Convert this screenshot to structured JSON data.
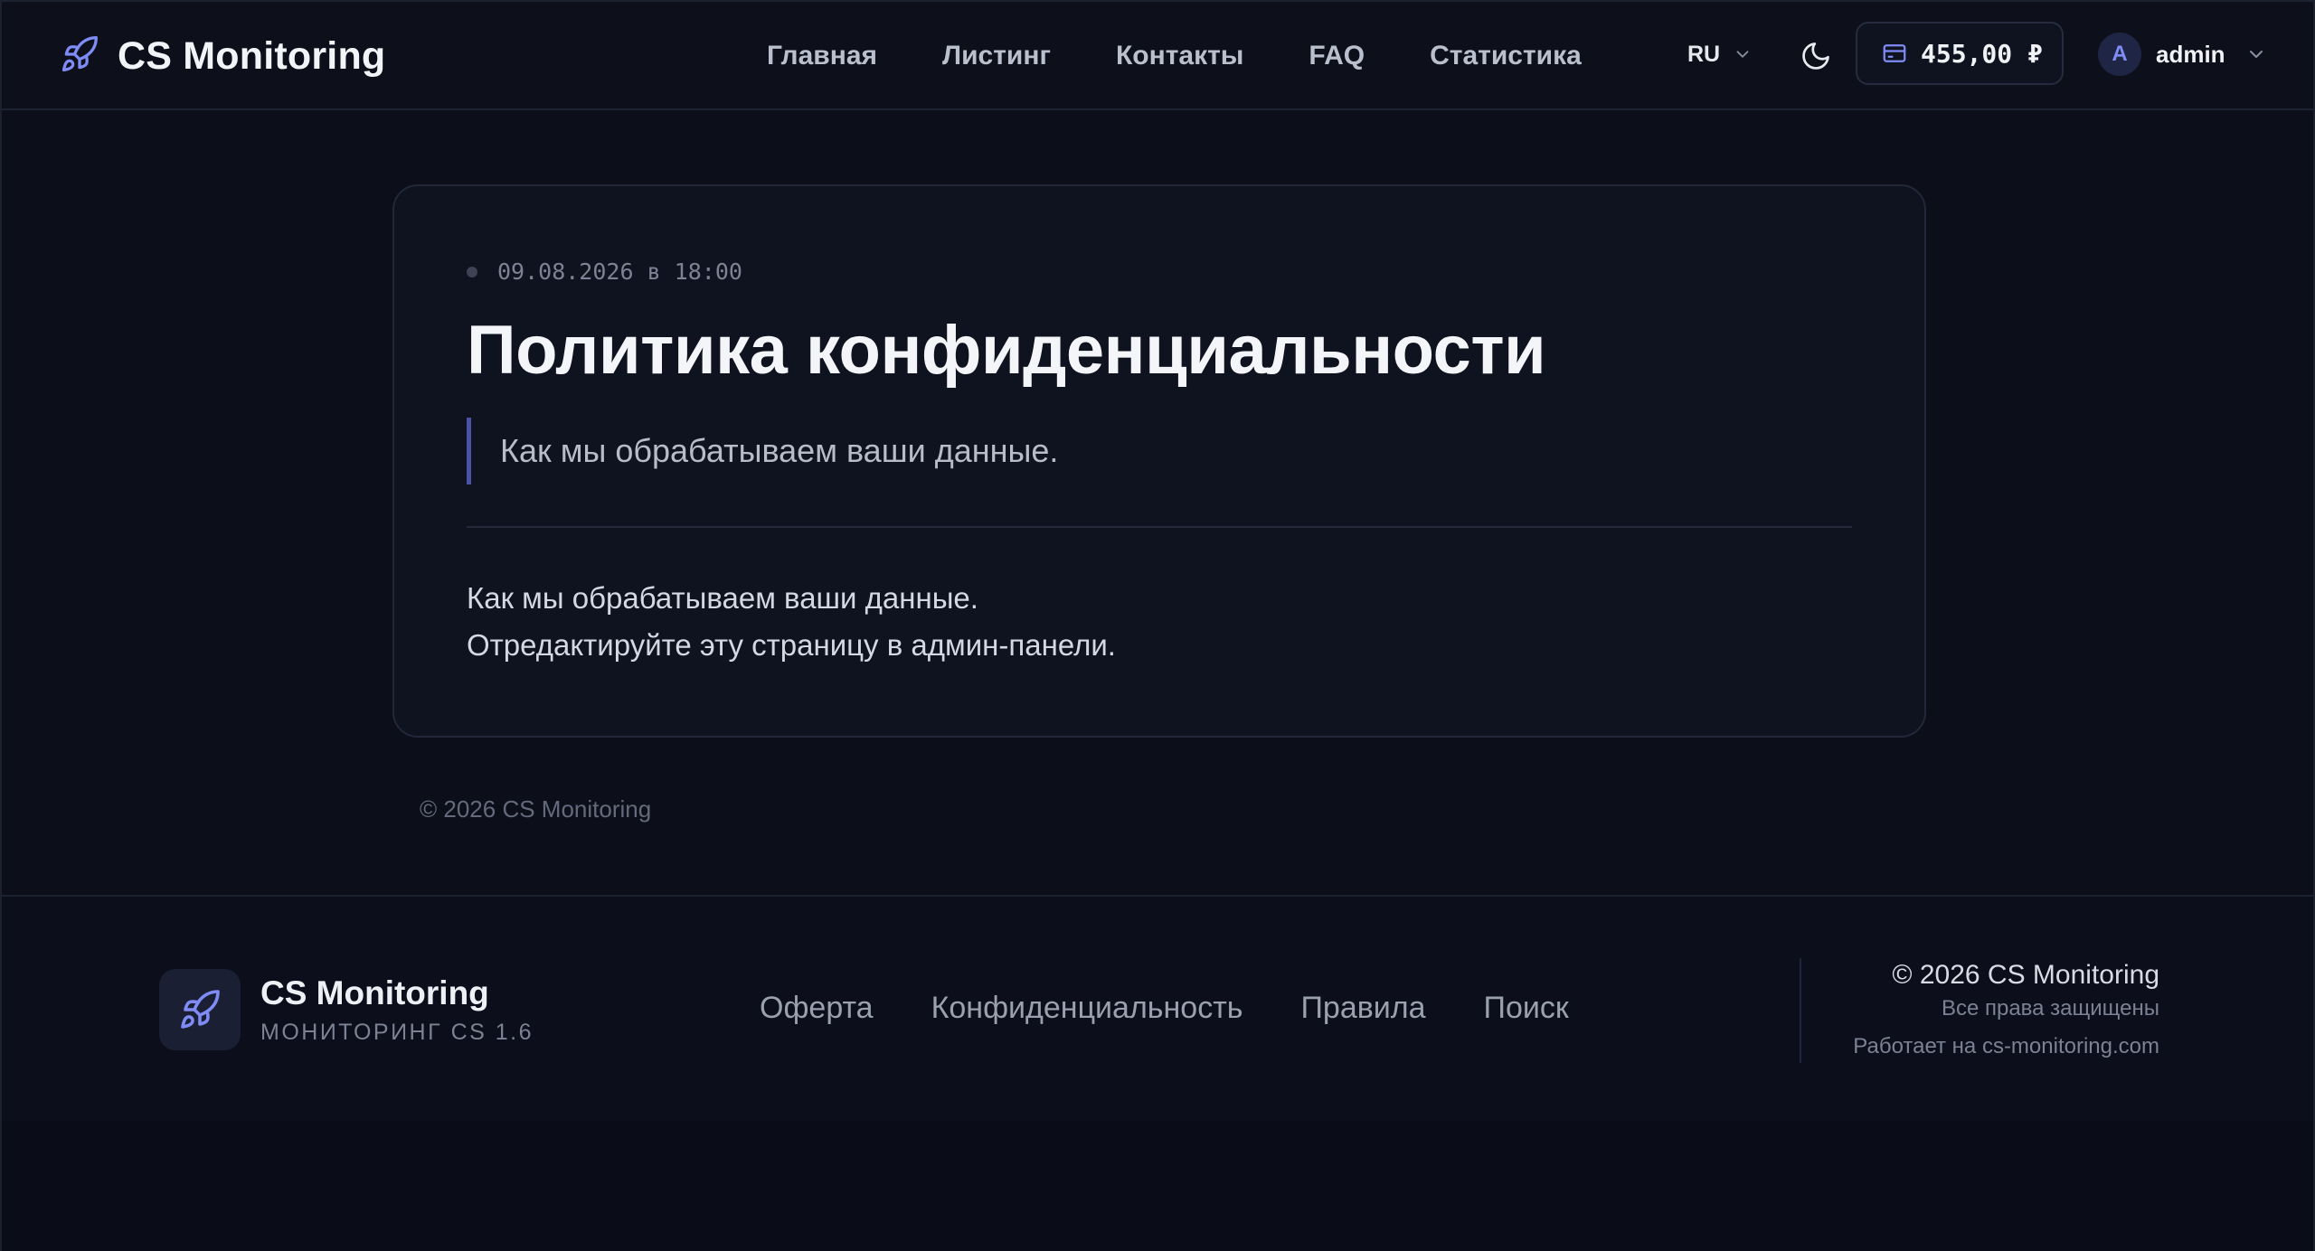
{
  "header": {
    "brand": "CS Monitoring",
    "nav": [
      "Главная",
      "Листинг",
      "Контакты",
      "FAQ",
      "Статистика"
    ],
    "language": "RU",
    "balance": "455,00 ₽",
    "user": {
      "avatar_letter": "A",
      "name": "admin"
    }
  },
  "article": {
    "date": "09.08.2026 в 18:00",
    "title": "Политика конфиденциальности",
    "lead": "Как мы обрабатываем ваши данные.",
    "body": [
      "Как мы обрабатываем ваши данные.",
      "Отредактируйте эту страницу в админ-панели."
    ]
  },
  "page_copyright": "© 2026 CS Monitoring",
  "footer": {
    "brand_title": "CS Monitoring",
    "brand_subtitle": "МОНИТОРИНГ CS 1.6",
    "links": [
      "Оферта",
      "Конфиденциальность",
      "Правила",
      "Поиск"
    ],
    "copyright": "© 2026 CS Monitoring",
    "rights": "Все права защищены",
    "powered": "Работает на cs-monitoring.com"
  },
  "colors": {
    "background": "#0c0f1a",
    "accent": "#7f8cf6",
    "card": "#0f131f",
    "lead_border": "#4c53a6"
  },
  "icons": {
    "brand": "rocket-icon",
    "language": "chevron-down-icon",
    "theme": "moon-icon",
    "balance": "wallet-icon",
    "user_menu": "chevron-down-icon"
  }
}
